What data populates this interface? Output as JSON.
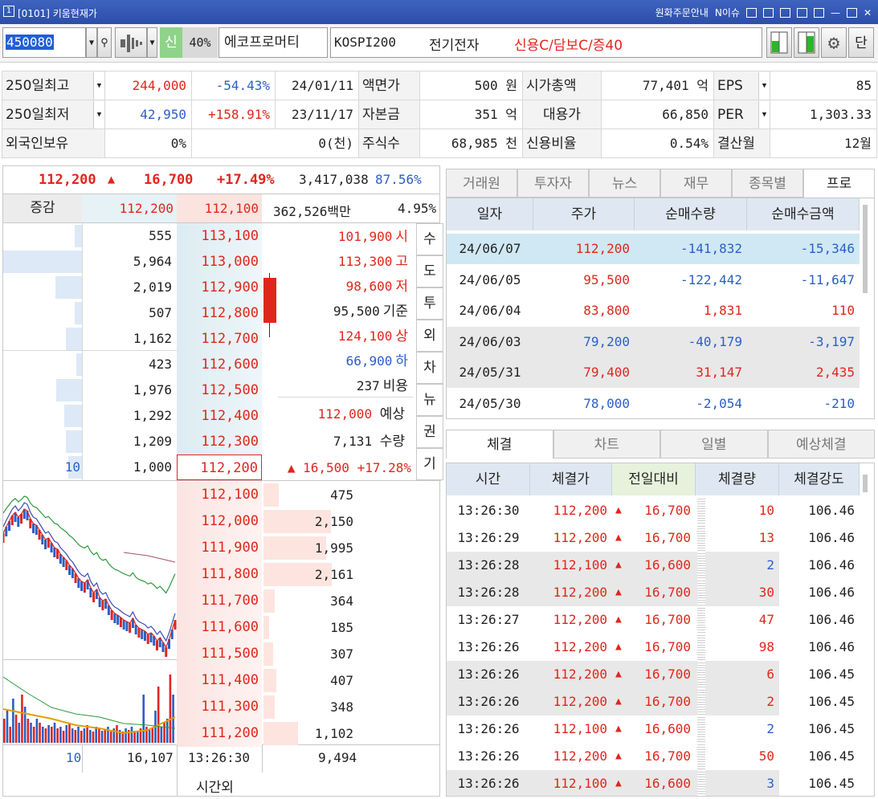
{
  "window": {
    "number": "1",
    "title": "[0101] 키움현재가",
    "links": [
      "원화주문안내",
      "N이슈"
    ]
  },
  "toolbar": {
    "code": "450080",
    "credit": "신",
    "margin": "40%",
    "stock_name": "에코프로머티",
    "index": "KOSPI200",
    "sector": "전기전자",
    "credit_info": "신용C/담보C/증40",
    "single_btn": "단"
  },
  "info": {
    "r1": {
      "label": "250일최고",
      "price": "244,000",
      "rate": "-54.43%",
      "date": "24/01/11",
      "label2": "액면가",
      "val2": "500 원",
      "label3": "시가총액",
      "val3": "77,401 억",
      "label4": "EPS",
      "val4": "85"
    },
    "r2": {
      "label": "250일최저",
      "price": "42,950",
      "rate": "+158.91%",
      "date": "23/11/17",
      "label2": "자본금",
      "val2": "351 억",
      "label3": "대용가",
      "val3": "66,850",
      "label4": "PER",
      "val4": "1,303.33"
    },
    "r3": {
      "label": "외국인보유",
      "pct": "0%",
      "qty": "0(천)",
      "label2": "주식수",
      "val2": "68,985 천",
      "label3": "신용비율",
      "val3": "0.54%",
      "label4": "결산월",
      "val4": "12월"
    }
  },
  "quote": {
    "price": "112,200",
    "arrow": "▲",
    "change": "16,700",
    "rate": "+17.49%",
    "volume": "3,417,038",
    "vol_ratio": "87.56%",
    "label": "증감",
    "bid_price": "112,200",
    "ask_price": "112,100",
    "amount": "362,526백만",
    "pct": "4.95%"
  },
  "asks": [
    {
      "qty": "555",
      "price": "113,100",
      "fill": 0.09
    },
    {
      "qty": "5,964",
      "price": "113,000",
      "fill": 1.0
    },
    {
      "qty": "2,019",
      "price": "112,900",
      "fill": 0.34
    },
    {
      "qty": "507",
      "price": "112,800",
      "fill": 0.09
    },
    {
      "qty": "1,162",
      "price": "112,700",
      "fill": 0.2
    },
    {
      "qty": "423",
      "price": "112,600",
      "fill": 0.07
    },
    {
      "qty": "1,976",
      "price": "112,500",
      "fill": 0.33
    },
    {
      "qty": "1,292",
      "price": "112,400",
      "fill": 0.22
    },
    {
      "qty": "1,209",
      "price": "112,300",
      "fill": 0.2
    },
    {
      "qty": "1,000",
      "price": "112,200",
      "fill": 0.17,
      "left": "10"
    }
  ],
  "bids": [
    {
      "price": "112,100",
      "qty": "475",
      "fill": 0.16
    },
    {
      "price": "112,000",
      "qty": "2,150",
      "fill": 0.72
    },
    {
      "price": "111,900",
      "qty": "1,995",
      "fill": 0.67
    },
    {
      "price": "111,800",
      "qty": "2,161",
      "fill": 0.73
    },
    {
      "price": "111,700",
      "qty": "364",
      "fill": 0.12
    },
    {
      "price": "111,600",
      "qty": "185",
      "fill": 0.06
    },
    {
      "price": "111,500",
      "qty": "307",
      "fill": 0.1
    },
    {
      "price": "111,400",
      "qty": "407",
      "fill": 0.14
    },
    {
      "price": "111,300",
      "qty": "348",
      "fill": 0.12
    },
    {
      "price": "111,200",
      "qty": "1,102",
      "fill": 0.37
    }
  ],
  "summary": [
    {
      "val": "101,900",
      "lbl": "시",
      "color": "#e0261c"
    },
    {
      "val": "113,300",
      "lbl": "고",
      "color": "#e0261c"
    },
    {
      "val": "98,600",
      "lbl": "저",
      "color": "#e0261c"
    },
    {
      "val": "95,500",
      "lbl": "기준",
      "color": "#222"
    },
    {
      "val": "124,100",
      "lbl": "상",
      "color": "#e0261c"
    },
    {
      "val": "66,900",
      "lbl": "하",
      "color": "#2a5fc7"
    },
    {
      "val": "237",
      "lbl": "비용",
      "color": "#222"
    }
  ],
  "expected": {
    "price": "112,000",
    "price_lbl": "예상",
    "qty": "7,131",
    "qty_lbl": "수량",
    "change": "▲ 16,500",
    "rate": "+17.28%"
  },
  "side_buttons": [
    "수",
    "도",
    "투",
    "외",
    "차",
    "뉴",
    "권",
    "기"
  ],
  "book_footer": {
    "left": "10",
    "total_ask": "16,107",
    "time": "13:26:30",
    "total_bid": "9,494",
    "after_hours": "시간외"
  },
  "tabs_top": [
    "거래원",
    "투자자",
    "뉴스",
    "재무",
    "종목별",
    "프로"
  ],
  "program_headers": [
    "일자",
    "주가",
    "순매수량",
    "순매수금액"
  ],
  "program_rows": [
    {
      "date": "24/06/07",
      "price": "112,200",
      "qty": "-141,832",
      "amt": "-15,346",
      "pc": "red",
      "qc": "blue",
      "ac": "blue"
    },
    {
      "date": "24/06/05",
      "price": "95,500",
      "qty": "-122,442",
      "amt": "-11,647",
      "pc": "red",
      "qc": "blue",
      "ac": "blue"
    },
    {
      "date": "24/06/04",
      "price": "83,800",
      "qty": "1,831",
      "amt": "110",
      "pc": "red",
      "qc": "red",
      "ac": "red"
    },
    {
      "date": "24/06/03",
      "price": "79,200",
      "qty": "-40,179",
      "amt": "-3,197",
      "pc": "blue",
      "qc": "blue",
      "ac": "blue"
    },
    {
      "date": "24/05/31",
      "price": "79,400",
      "qty": "31,147",
      "amt": "2,435",
      "pc": "red",
      "qc": "red",
      "ac": "red"
    },
    {
      "date": "24/05/30",
      "price": "78,000",
      "qty": "-2,054",
      "amt": "-210",
      "pc": "blue",
      "qc": "blue",
      "ac": "blue"
    }
  ],
  "tabs_bottom": [
    "체결",
    "차트",
    "일별",
    "예상체결"
  ],
  "trade_headers": [
    "시간",
    "체결가",
    "전일대비",
    "체결량",
    "체결강도"
  ],
  "trade_rows": [
    {
      "time": "13:26:30",
      "price": "112,200",
      "chg": "16,700",
      "qty": "10",
      "str": "106.46"
    },
    {
      "time": "13:26:29",
      "price": "112,200",
      "chg": "16,700",
      "qty": "13",
      "str": "106.46"
    },
    {
      "time": "13:26:28",
      "price": "112,100",
      "chg": "16,600",
      "qty": "2",
      "str": "106.46",
      "qc": "blue"
    },
    {
      "time": "13:26:28",
      "price": "112,200",
      "chg": "16,700",
      "qty": "30",
      "str": "106.46"
    },
    {
      "time": "13:26:27",
      "price": "112,200",
      "chg": "16,700",
      "qty": "47",
      "str": "106.46"
    },
    {
      "time": "13:26:26",
      "price": "112,200",
      "chg": "16,700",
      "qty": "98",
      "str": "106.46"
    },
    {
      "time": "13:26:26",
      "price": "112,200",
      "chg": "16,700",
      "qty": "6",
      "str": "106.45"
    },
    {
      "time": "13:26:26",
      "price": "112,200",
      "chg": "16,700",
      "qty": "2",
      "str": "106.45"
    },
    {
      "time": "13:26:26",
      "price": "112,100",
      "chg": "16,600",
      "qty": "2",
      "str": "106.45",
      "qc": "blue"
    },
    {
      "time": "13:26:26",
      "price": "112,200",
      "chg": "16,700",
      "qty": "50",
      "str": "106.45"
    },
    {
      "time": "13:26:26",
      "price": "112,100",
      "chg": "16,600",
      "qty": "3",
      "str": "106.45",
      "qc": "blue"
    }
  ],
  "mini_chart": {
    "price_path": [
      70,
      62,
      55,
      48,
      44,
      50,
      46,
      40,
      42,
      52,
      58,
      60,
      66,
      72,
      78,
      76,
      82,
      88,
      90,
      96,
      100,
      104,
      110,
      114,
      120,
      126,
      130,
      132,
      128,
      138,
      144,
      140,
      150,
      154,
      152,
      160,
      166,
      170,
      172,
      175,
      178,
      180,
      182,
      176,
      184,
      188,
      190,
      192,
      196,
      194,
      198,
      204,
      200,
      206,
      212,
      202,
      190,
      178
    ],
    "volume": [
      30,
      40,
      20,
      55,
      35,
      25,
      60,
      45,
      30,
      25,
      20,
      30,
      25,
      20,
      18,
      22,
      20,
      25,
      18,
      20,
      15,
      22,
      25,
      18,
      16,
      20,
      15,
      18,
      22,
      16,
      14,
      20,
      18,
      15,
      16,
      20,
      14,
      18,
      22,
      16,
      14,
      18,
      16,
      20,
      15,
      14,
      18,
      60,
      20,
      16,
      18,
      40,
      70,
      20,
      25,
      30,
      85,
      60
    ]
  }
}
